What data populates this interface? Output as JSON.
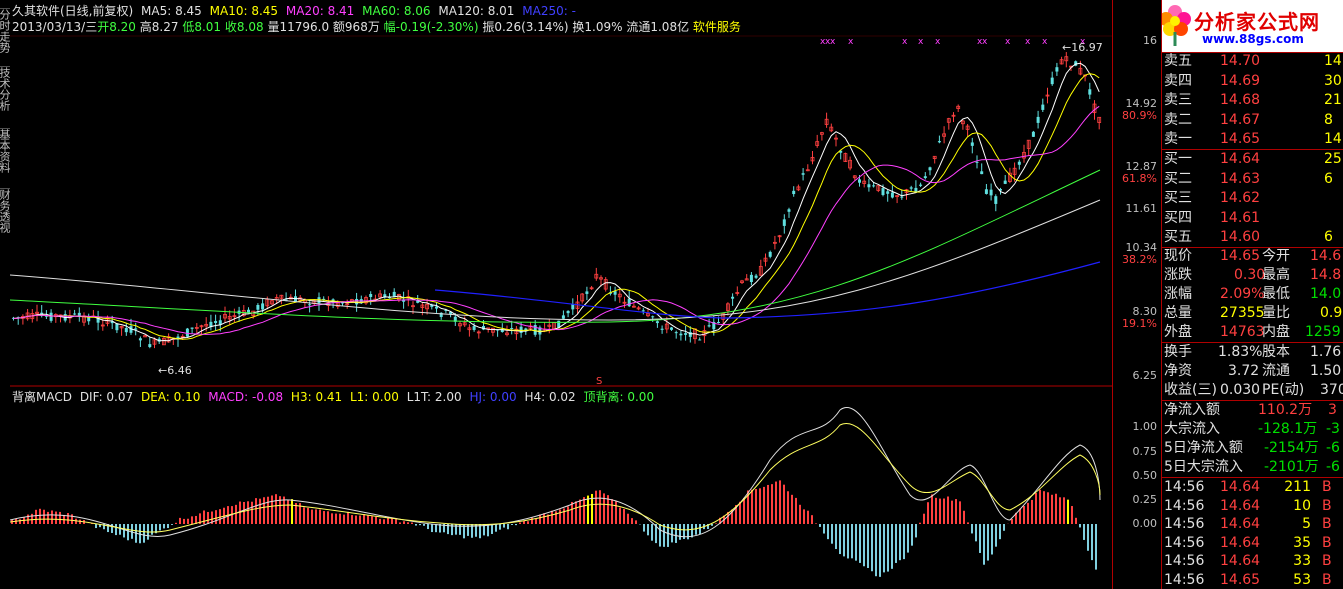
{
  "header": {
    "title": "久其软件(日线,前复权)",
    "ma5": "MA5: 8.45",
    "ma10": "MA10: 8.45",
    "ma20": "MA20: 8.41",
    "ma60": "MA60: 8.06",
    "ma120": "MA120: 8.01",
    "ma250": "MA250: -",
    "date": "2013/03/13/三",
    "open": "开8.20",
    "high": "高8.27",
    "low": "低8.01",
    "close": "收8.08",
    "volume": "量11796.0",
    "amount": "额968万",
    "change": "幅-0.19(-2.30%)",
    "amplitude": "振0.26(3.14%)",
    "turnover": "换1.09%",
    "float": "流通1.08亿",
    "service": "软件服务"
  },
  "left_tabs": [
    "分时走势",
    "技术分析",
    "基本资料",
    "财务透视"
  ],
  "chart_marks": {
    "high_label": "16.97",
    "low_label": "6.46",
    "s_marker": "S"
  },
  "macd_header": {
    "name": "背离MACD",
    "dif": "DIF: 0.07",
    "dea": "DEA: 0.10",
    "macd": "MACD: -0.08",
    "h3": "H3: 0.41",
    "l1": "L1: 0.00",
    "l1t": "L1T: 2.00",
    "hj": "HJ: 0.00",
    "h4": "H4: 0.02",
    "top_div": "顶背离: 0.00"
  },
  "price_axis": [
    {
      "label": "16",
      "color": "#c0c0c0"
    },
    {
      "label": "14.92",
      "color": "#c0c0c0"
    },
    {
      "label": "80.9%",
      "color": "#ff4040"
    },
    {
      "label": "12.87",
      "color": "#c0c0c0"
    },
    {
      "label": "61.8%",
      "color": "#ff4040"
    },
    {
      "label": "11.61",
      "color": "#c0c0c0"
    },
    {
      "label": "10.34",
      "color": "#c0c0c0"
    },
    {
      "label": "38.2%",
      "color": "#ff4040"
    },
    {
      "label": "8.30",
      "color": "#c0c0c0"
    },
    {
      "label": "19.1%",
      "color": "#ff4040"
    },
    {
      "label": "6.25",
      "color": "#c0c0c0"
    }
  ],
  "macd_axis": [
    "1.00",
    "0.75",
    "0.50",
    "0.25",
    "0.00"
  ],
  "logo": {
    "brand": "分析家公式网",
    "url": "www.88gs.com"
  },
  "order_book": {
    "asks": [
      {
        "label": "卖五",
        "price": "14.70",
        "vol": "14"
      },
      {
        "label": "卖四",
        "price": "14.69",
        "vol": "30"
      },
      {
        "label": "卖三",
        "price": "14.68",
        "vol": "21"
      },
      {
        "label": "卖二",
        "price": "14.67",
        "vol": "8"
      },
      {
        "label": "卖一",
        "price": "14.65",
        "vol": "14"
      }
    ],
    "bids": [
      {
        "label": "买一",
        "price": "14.64",
        "vol": "25"
      },
      {
        "label": "买二",
        "price": "14.63",
        "vol": "6"
      },
      {
        "label": "买三",
        "price": "14.62",
        "vol": ""
      },
      {
        "label": "买四",
        "price": "14.61",
        "vol": ""
      },
      {
        "label": "买五",
        "price": "14.60",
        "vol": "6"
      }
    ]
  },
  "quote": {
    "rows": [
      {
        "l1": "现价",
        "v1": "14.65",
        "l2": "今开",
        "v2": "14.6"
      },
      {
        "l1": "涨跌",
        "v1": "0.30",
        "l2": "最高",
        "v2": "14.8"
      },
      {
        "l1": "涨幅",
        "v1": "2.09%",
        "l2": "最低",
        "v2": "14.0"
      },
      {
        "l1": "总量",
        "v1": "27355",
        "l2": "量比",
        "v2": "0.9"
      },
      {
        "l1": "外盘",
        "v1": "14763",
        "l2": "内盘",
        "v2": "1259"
      }
    ]
  },
  "fundamentals": [
    {
      "l1": "换手",
      "v1": "1.83%",
      "l2": "股本",
      "v2": "1.76"
    },
    {
      "l1": "净资",
      "v1": "3.72",
      "l2": "流通",
      "v2": "1.50"
    },
    {
      "l1": "收益(三)",
      "v1": "0.030",
      "l2": "PE(动)",
      "v2": "370"
    }
  ],
  "fund_flow": [
    {
      "label": "净流入额",
      "value": "110.2万",
      "extra": "3"
    },
    {
      "label": "大宗流入",
      "value": "-128.1万",
      "extra": "-3"
    },
    {
      "label": "5日净流入额",
      "value": "-2154万",
      "extra": "-6"
    },
    {
      "label": "5日大宗流入",
      "value": "-2101万",
      "extra": "-6"
    }
  ],
  "ticks": [
    {
      "time": "14:56",
      "price": "14.64",
      "vol": "211",
      "side": "B"
    },
    {
      "time": "14:56",
      "price": "14.64",
      "vol": "10",
      "side": "B"
    },
    {
      "time": "14:56",
      "price": "14.64",
      "vol": "5",
      "side": "B"
    },
    {
      "time": "14:56",
      "price": "14.64",
      "vol": "35",
      "side": "B"
    },
    {
      "time": "14:56",
      "price": "14.64",
      "vol": "33",
      "side": "B"
    },
    {
      "time": "14:56",
      "price": "14.65",
      "vol": "53",
      "side": "B"
    }
  ],
  "colors": {
    "up": "#ff4040",
    "down": "#60e0e0",
    "ma5": "#ffffff",
    "ma10": "#ffff00",
    "ma20": "#ff40ff",
    "ma60": "#40ff40",
    "ma120": "#e0e0e0",
    "ma250": "#2020ff",
    "frame": "#b00000"
  }
}
